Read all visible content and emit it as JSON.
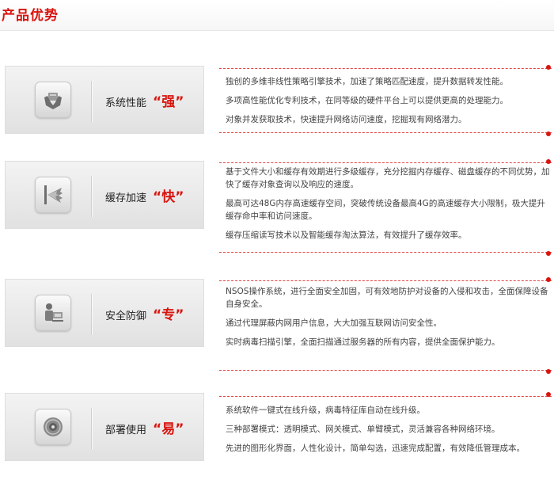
{
  "section_title": "产品优势",
  "items": [
    {
      "icon": "hands-icon",
      "label": "系统性能",
      "highlight": "“强”",
      "lines": [
        "独创的多维非线性策略引擎技术，加速了策略匹配速度，提升数据转发性能。",
        "多项高性能优化专利技术，在同等级的硬件平台上可以提供更高的处理能力。",
        "对象并发获取技术，快速提升网络访问速度，挖掘现有网络潜力。"
      ]
    },
    {
      "icon": "speed-burst-icon",
      "label": "缓存加速",
      "highlight": "“快”",
      "lines": [
        "基于文件大小和缓存有效期进行多级缓存，充分挖掘内存缓存、磁盘缓存的不同优势，加快了缓存对象查询以及响应的速度。",
        "最高可达48G内存高速缓存空间，突破传统设备最高4G的高速缓存大小限制，极大提升缓存命中率和访问速度。",
        "缓存压缩读写技术以及智能缓存淘汰算法，有效提升了缓存效率。"
      ]
    },
    {
      "icon": "user-workstation-icon",
      "label": "安全防御",
      "highlight": "“专”",
      "lines": [
        "NSOS操作系统，进行全面安全加固，可有效地防护对设备的入侵和攻击，全面保障设备自身安全。",
        "通过代理屏蔽内网用户信息，大大加强互联网访问安全性。",
        "实时病毒扫描引擎，全面扫描通过服务器的所有内容，提供全面保护能力。"
      ]
    },
    {
      "icon": "disc-icon",
      "label": "部署使用",
      "highlight": "“易”",
      "lines": [
        "系统软件一键式在线升级，病毒特征库自动在线升级。",
        "三种部署模式：透明模式、网关模式、单臂模式，灵活兼容各种网络环境。",
        "先进的图形化界面，人性化设计，简单勾选，迅速完成配置，有效降低管理成本。"
      ]
    }
  ]
}
